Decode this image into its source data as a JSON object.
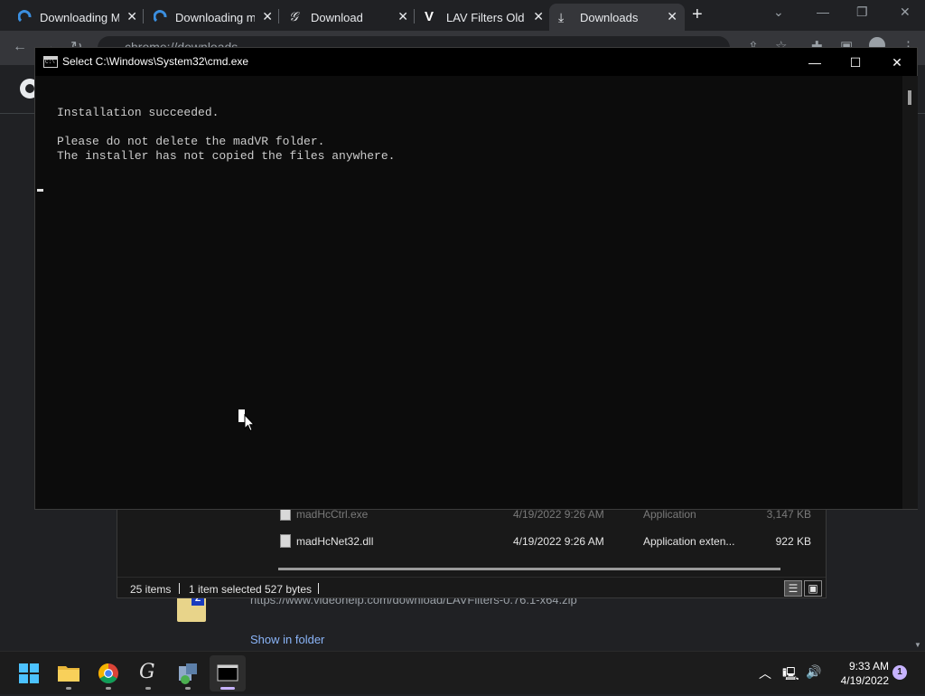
{
  "chrome": {
    "tabs": [
      {
        "title": "Downloading M",
        "icon": "blue-swirl-icon"
      },
      {
        "title": "Downloading m",
        "icon": "blue-swirl-icon"
      },
      {
        "title": "Download",
        "icon": "script-g-icon"
      },
      {
        "title": "LAV Filters Old V",
        "icon": "v-logo-icon"
      },
      {
        "title": "Downloads",
        "icon": "download-icon"
      }
    ],
    "address": "chrome://downloads",
    "download_url": "https://www.videohelp.com/download/LAVFilters-0.76.1-x64.zip",
    "show_in_folder": "Show in folder"
  },
  "explorer": {
    "rows": [
      {
        "name": "madHcCtrl.exe",
        "date": "4/19/2022 9:26 AM",
        "type": "Application",
        "size": "3,147 KB",
        "faded": true
      },
      {
        "name": "madHcNet32.dll",
        "date": "4/19/2022 9:26 AM",
        "type": "Application exten...",
        "size": "922 KB",
        "faded": false
      }
    ],
    "status": {
      "items": "25 items",
      "selected": "1 item selected",
      "size": "527 bytes"
    }
  },
  "cmd": {
    "title": "Select C:\\Windows\\System32\\cmd.exe",
    "lines": [
      "Installation succeeded.",
      "",
      "Please do not delete the madVR folder.",
      "The installer has not copied the files anywhere."
    ],
    "colors": {
      "background": "#0c0c0c",
      "text": "#cccccc"
    }
  },
  "taskbar": {
    "apps": [
      "start-icon",
      "file-explorer-icon",
      "chrome-icon",
      "script-g-icon",
      "install-tool-icon",
      "terminal-icon"
    ],
    "time": "9:33 AM",
    "date": "4/19/2022",
    "notification_count": "1"
  }
}
